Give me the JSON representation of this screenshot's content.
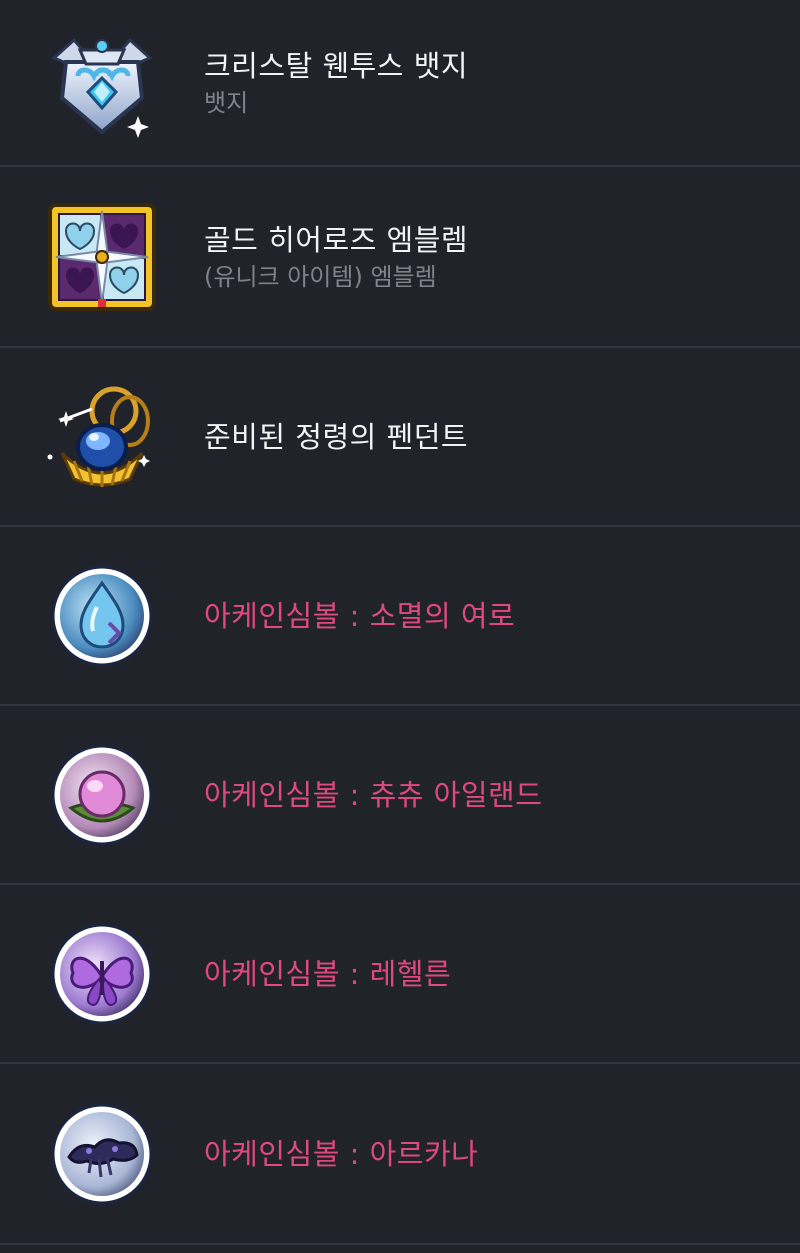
{
  "items": [
    {
      "name": "크리스탈 웬투스 뱃지",
      "sub": "뱃지",
      "icon": "crystal-badge-icon",
      "color": "#f2f3f5"
    },
    {
      "name": "골드 히어로즈 엠블렘",
      "sub": "(유니크 아이템) 엠블렘",
      "icon": "gold-emblem-icon",
      "color": "#f2f3f5"
    },
    {
      "name": "준비된 정령의 펜던트",
      "sub": "",
      "icon": "spirit-pendant-icon",
      "color": "#f2f3f5"
    },
    {
      "name": "아케인심볼 : 소멸의 여로",
      "sub": "",
      "icon": "arcane-symbol-vanishing-journey-icon",
      "color": "#e0497e"
    },
    {
      "name": "아케인심볼 : 츄츄 아일랜드",
      "sub": "",
      "icon": "arcane-symbol-chuchu-island-icon",
      "color": "#e0497e"
    },
    {
      "name": "아케인심볼 : 레헬른",
      "sub": "",
      "icon": "arcane-symbol-lachelein-icon",
      "color": "#e0497e"
    },
    {
      "name": "아케인심볼 : 아르카나",
      "sub": "",
      "icon": "arcane-symbol-arcana-icon",
      "color": "#e0497e"
    }
  ],
  "colors": {
    "background": "#21232a",
    "divider": "#33363f",
    "primary_text": "#f2f3f5",
    "secondary_text": "#7f828a",
    "arcane_text": "#e0497e"
  }
}
